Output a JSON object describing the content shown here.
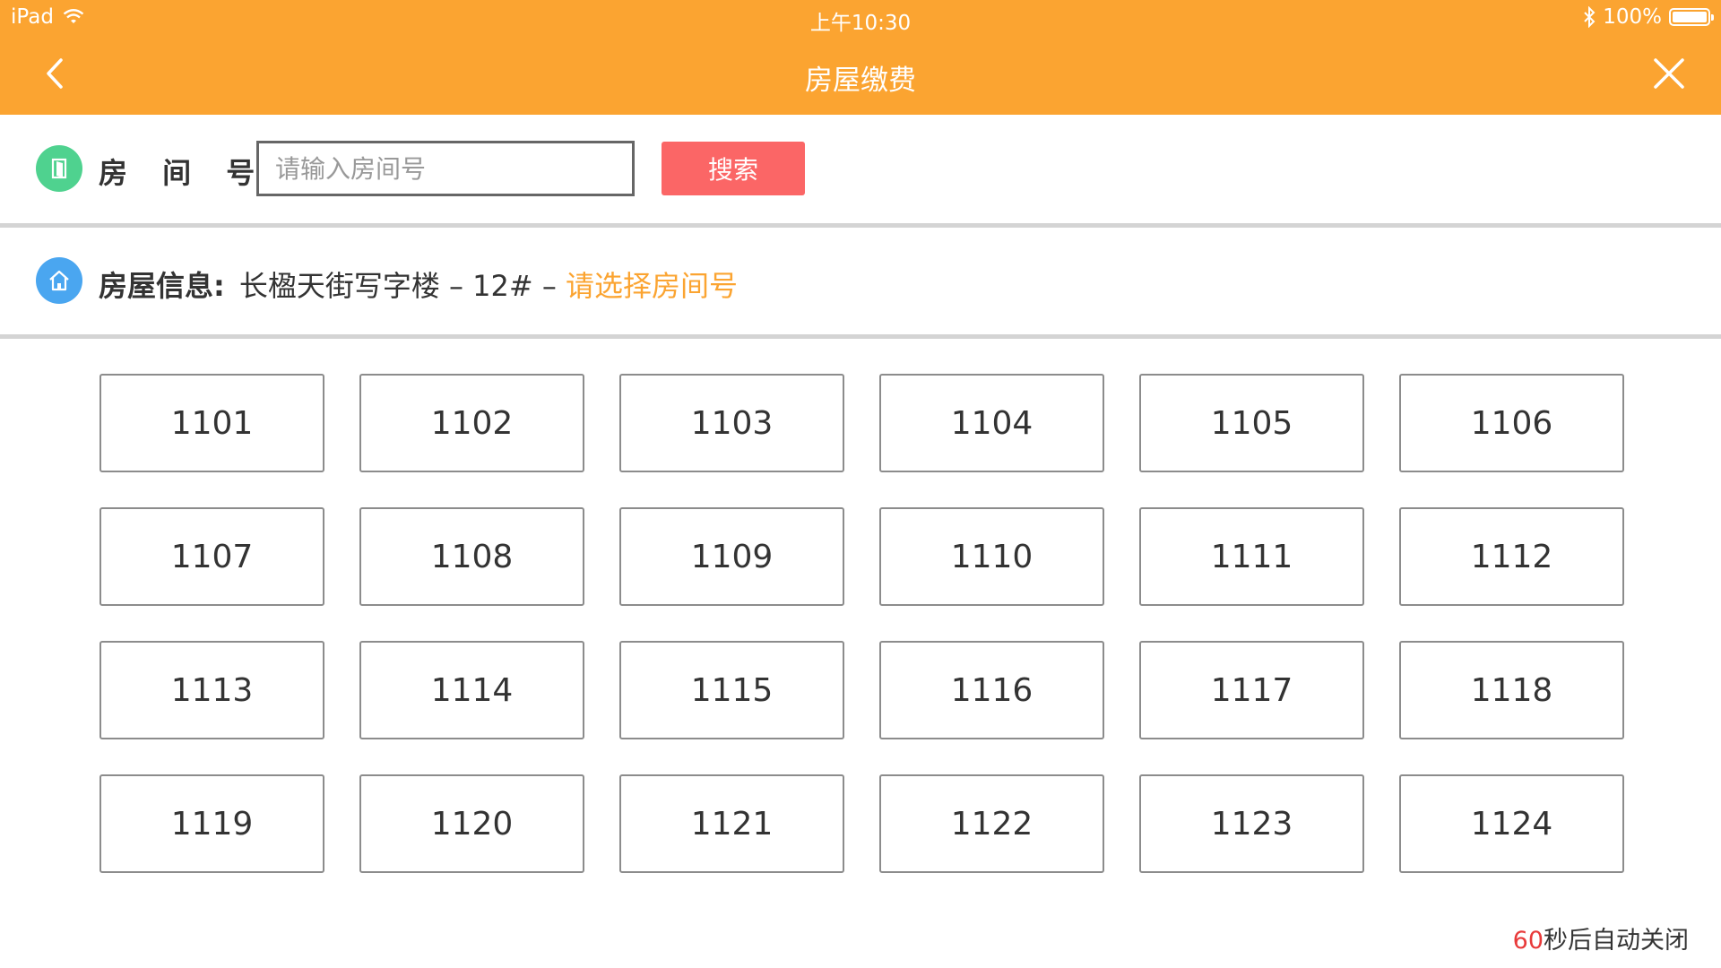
{
  "status_bar": {
    "device": "iPad",
    "time": "上午10:30",
    "battery": "100%"
  },
  "nav": {
    "title": "房屋缴费"
  },
  "search": {
    "label": "房 间 号：",
    "placeholder": "请输入房间号",
    "value": "",
    "button": "搜索"
  },
  "house_info": {
    "label": "房屋信息:",
    "building": "长楹天街写字楼 – 12# – ",
    "prompt": "请选择房间号"
  },
  "rooms": [
    "1101",
    "1102",
    "1103",
    "1104",
    "1105",
    "1106",
    "1107",
    "1108",
    "1109",
    "1110",
    "1111",
    "1112",
    "1113",
    "1114",
    "1115",
    "1116",
    "1117",
    "1118",
    "1119",
    "1120",
    "1121",
    "1122",
    "1123",
    "1124"
  ],
  "countdown": {
    "seconds": "60",
    "text": "秒后自动关闭"
  },
  "colors": {
    "header": "#fba431",
    "search_button": "#fb6666",
    "room_icon": "#4fd28f",
    "house_icon": "#4aa6f0",
    "prompt": "#fba431",
    "countdown_number": "#e83a3a"
  }
}
